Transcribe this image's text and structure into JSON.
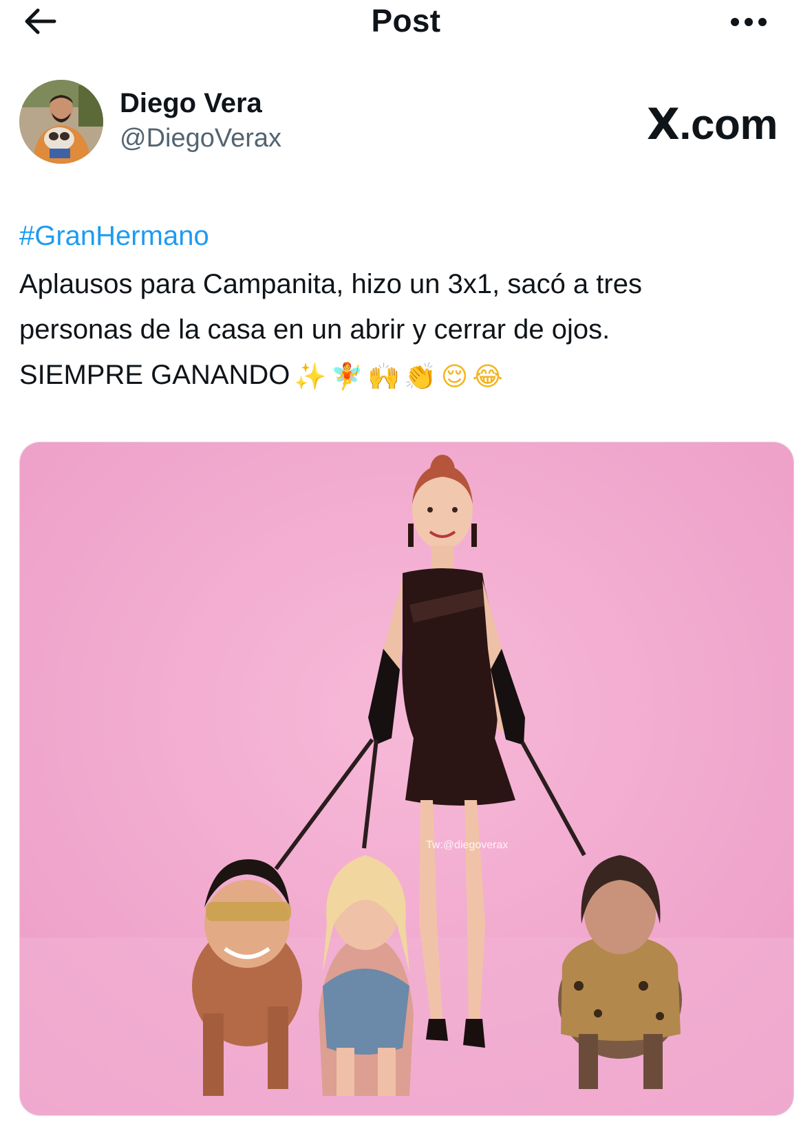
{
  "header": {
    "title": "Post",
    "back_icon": "arrow-left-icon",
    "more_icon": "more-horizontal-icon"
  },
  "author": {
    "name": "Diego Vera",
    "handle": "@DiegoVerax",
    "avatar_icon": "avatar-photo"
  },
  "brand": {
    "mark": "X",
    "suffix": ".com"
  },
  "post": {
    "hashtag": "#GranHermano",
    "lines": [
      "Aplausos para Campanita, hizo un 3x1, sacó a tres",
      "personas de la casa en un abrir y cerrar de ojos.",
      "SIEMPRE GANANDO"
    ],
    "emojis": {
      "sparkles": "✨",
      "fairy": "🧚",
      "raised_hands": "🙌",
      "clapping": "👏",
      "relieved": "😌",
      "joy": "😂"
    }
  },
  "media": {
    "watermark": "Tw:@diegoverax",
    "kind": "photo"
  },
  "colors": {
    "link": "#1d9bf0",
    "text": "#0f1419",
    "muted": "#536471",
    "media_background": "#f1a8cf"
  }
}
